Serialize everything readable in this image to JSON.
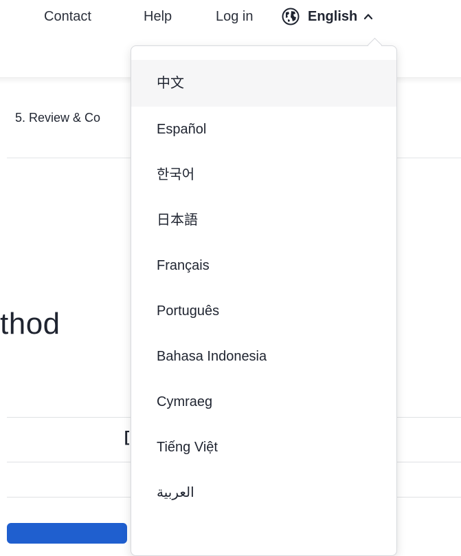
{
  "nav": {
    "contact": "Contact",
    "help": "Help",
    "login": "Log in",
    "language_label": "English",
    "language_icon": "globe-icon",
    "chevron_icon": "chevron-up-icon"
  },
  "background": {
    "step_label": "5. Review & Co",
    "title_fragment": "thod",
    "cut_char": "[",
    "primary_color": "#1f5fcf"
  },
  "languages": [
    "中文",
    "Español",
    "한국어",
    "日本語",
    "Français",
    "Português",
    "Bahasa Indonesia",
    "Cymraeg",
    "Tiếng Việt",
    "العربية"
  ]
}
